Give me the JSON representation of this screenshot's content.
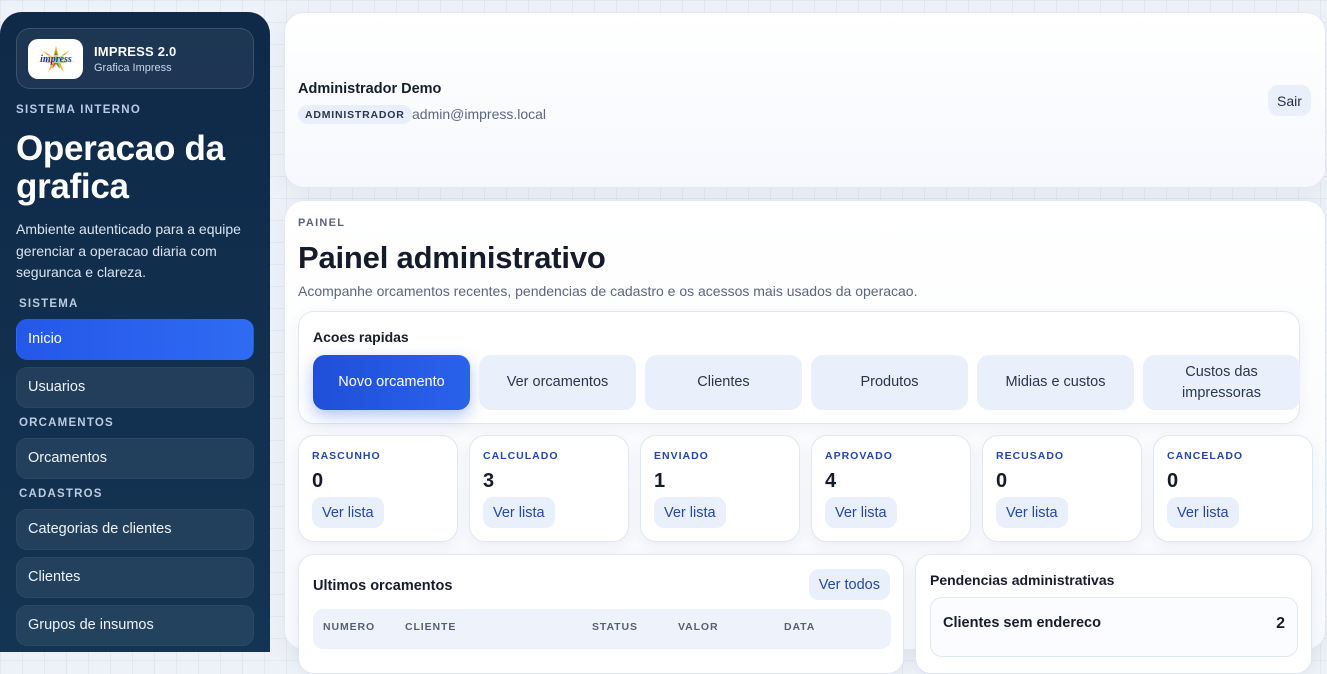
{
  "brand": {
    "logo_text": "impress",
    "name": "IMPRESS 2.0",
    "subtitle": "Grafica Impress"
  },
  "sidebar": {
    "eyebrow": "SISTEMA INTERNO",
    "heading": "Operacao da grafica",
    "description": "Ambiente autenticado para a equipe gerenciar a operacao diaria com seguranca e clareza.",
    "groups": [
      {
        "label": "SISTEMA",
        "items": [
          {
            "label": "Inicio",
            "active": true
          },
          {
            "label": "Usuarios"
          }
        ]
      },
      {
        "label": "ORCAMENTOS",
        "items": [
          {
            "label": "Orcamentos"
          }
        ]
      },
      {
        "label": "CADASTROS",
        "items": [
          {
            "label": "Categorias de clientes"
          },
          {
            "label": "Clientes"
          },
          {
            "label": "Grupos de insumos"
          }
        ]
      }
    ]
  },
  "header": {
    "user_name": "Administrador Demo",
    "role": "ADMINISTRADOR",
    "email": "admin@impress.local",
    "logout_label": "Sair"
  },
  "main": {
    "eyebrow": "PAINEL",
    "title": "Painel administrativo",
    "subtitle": "Acompanhe orcamentos recentes, pendencias de cadastro e os acessos mais usados da operacao.",
    "quick_actions": {
      "title": "Acoes rapidas",
      "buttons": [
        {
          "label": "Novo orcamento",
          "primary": true
        },
        {
          "label": "Ver orcamentos"
        },
        {
          "label": "Clientes"
        },
        {
          "label": "Produtos"
        },
        {
          "label": "Midias e custos"
        },
        {
          "label": "Custos das impressoras"
        }
      ]
    },
    "status_cards": [
      {
        "label": "RASCUNHO",
        "value": "0",
        "link": "Ver lista"
      },
      {
        "label": "CALCULADO",
        "value": "3",
        "link": "Ver lista"
      },
      {
        "label": "ENVIADO",
        "value": "1",
        "link": "Ver lista"
      },
      {
        "label": "APROVADO",
        "value": "4",
        "link": "Ver lista"
      },
      {
        "label": "RECUSADO",
        "value": "0",
        "link": "Ver lista"
      },
      {
        "label": "CANCELADO",
        "value": "0",
        "link": "Ver lista"
      }
    ],
    "recent": {
      "title": "Ultimos orcamentos",
      "see_all": "Ver todos",
      "columns": [
        "NUMERO",
        "CLIENTE",
        "STATUS",
        "VALOR",
        "DATA"
      ]
    },
    "pending": {
      "title": "Pendencias administrativas",
      "items": [
        {
          "label": "Clientes sem endereco",
          "count": "2"
        }
      ]
    }
  }
}
